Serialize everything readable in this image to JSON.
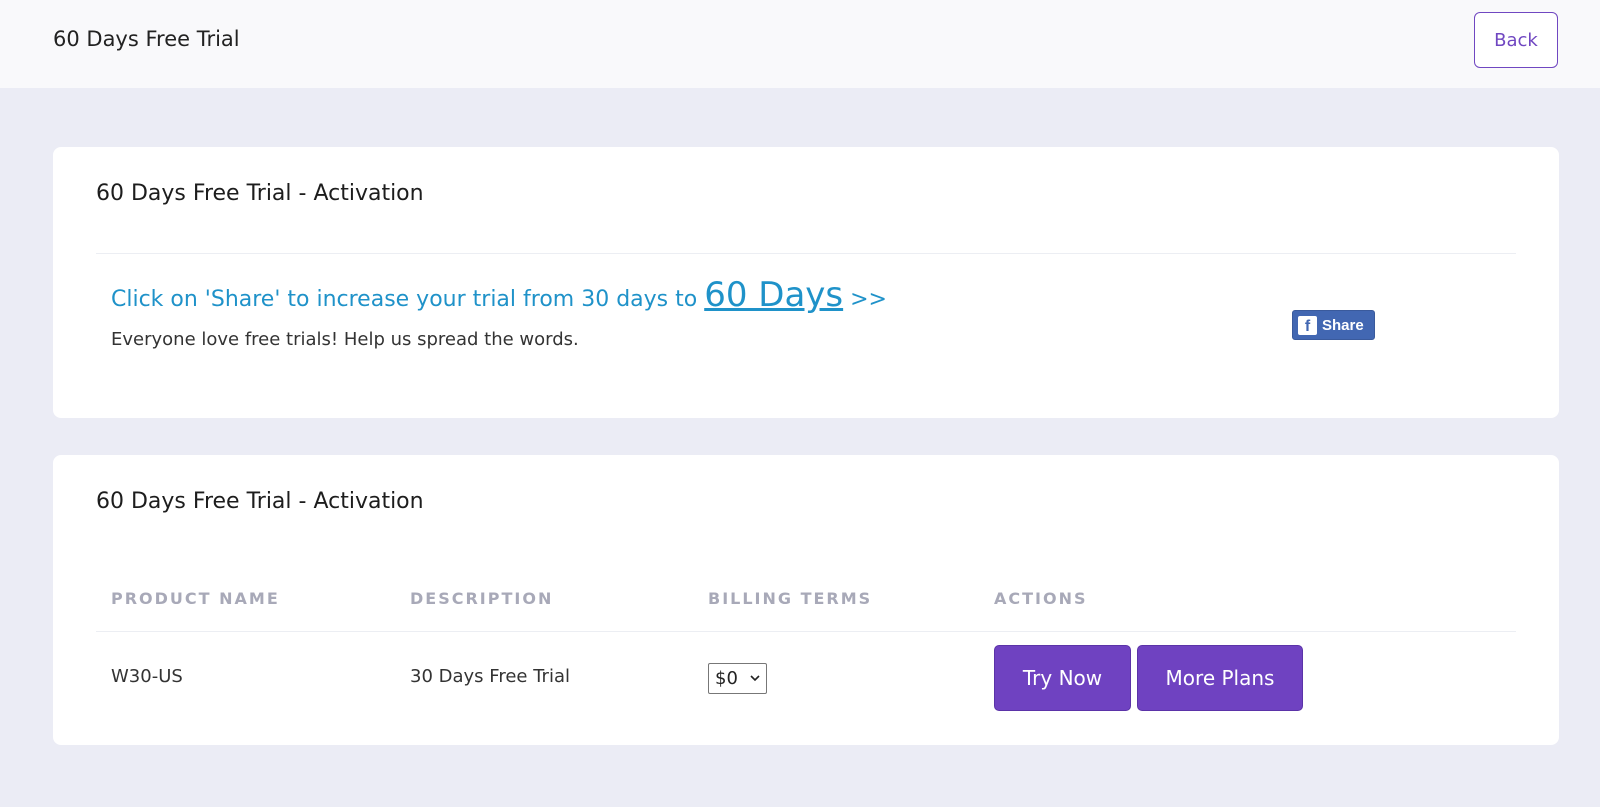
{
  "header": {
    "title": "60 Days Free Trial",
    "back_label": "Back"
  },
  "share_card": {
    "title": "60 Days Free Trial - Activation",
    "promo_prefix": "Click on 'Share' to increase your trial from 30 days to",
    "promo_link": "60 Days",
    "promo_suffix": ">>",
    "subtext": "Everyone love free trials! Help us spread the words.",
    "fb_button_label": "Share"
  },
  "products_card": {
    "title": "60 Days Free Trial - Activation",
    "columns": [
      "PRODUCT NAME",
      "DESCRIPTION",
      "BILLING TERMS",
      "ACTIONS"
    ],
    "rows": [
      {
        "product_name": "W30-US",
        "description": "30 Days Free Trial",
        "billing_term": "$0",
        "try_label": "Try Now",
        "more_label": "More Plans"
      }
    ]
  },
  "colors": {
    "accent": "#6f42c1",
    "link": "#1f92c9",
    "facebook": "#4267b2",
    "background": "#ebecf5"
  }
}
